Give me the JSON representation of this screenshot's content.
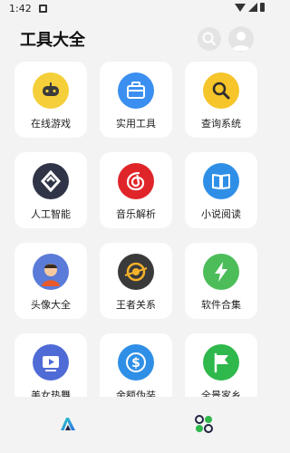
{
  "status": {
    "time": "1:42"
  },
  "header": {
    "title": "工具大全"
  },
  "colors": {
    "game": "#f5cf3a",
    "tools": "#3b8ff0",
    "query": "#f5c52a",
    "ai": "#2f3447",
    "music": "#e0252a",
    "reading": "#2f8fe6",
    "avatar_bg": "#5a7bd8",
    "glory": "#3a3a3a",
    "software": "#4dbd5a",
    "dance": "#4f6bd6",
    "balance": "#2f8fe6",
    "panorama": "#2fb84c"
  },
  "tools": [
    {
      "label": "在线游戏",
      "icon": "gamepad-icon"
    },
    {
      "label": "实用工具",
      "icon": "toolbox-icon"
    },
    {
      "label": "查询系统",
      "icon": "magnifier-icon"
    },
    {
      "label": "人工智能",
      "icon": "ai-logo-icon"
    },
    {
      "label": "音乐解析",
      "icon": "music-logo-icon"
    },
    {
      "label": "小说阅读",
      "icon": "book-icon"
    },
    {
      "label": "头像大全",
      "icon": "avatar-icon"
    },
    {
      "label": "王者关系",
      "icon": "target-icon"
    },
    {
      "label": "软件合集",
      "icon": "lightning-icon"
    },
    {
      "label": "美女热舞",
      "icon": "play-icon"
    },
    {
      "label": "余额伪装",
      "icon": "dollar-icon"
    },
    {
      "label": "全景家乡",
      "icon": "flag-icon"
    }
  ],
  "nav": [
    {
      "icon": "home-logo-icon"
    },
    {
      "icon": "apps-icon"
    }
  ]
}
